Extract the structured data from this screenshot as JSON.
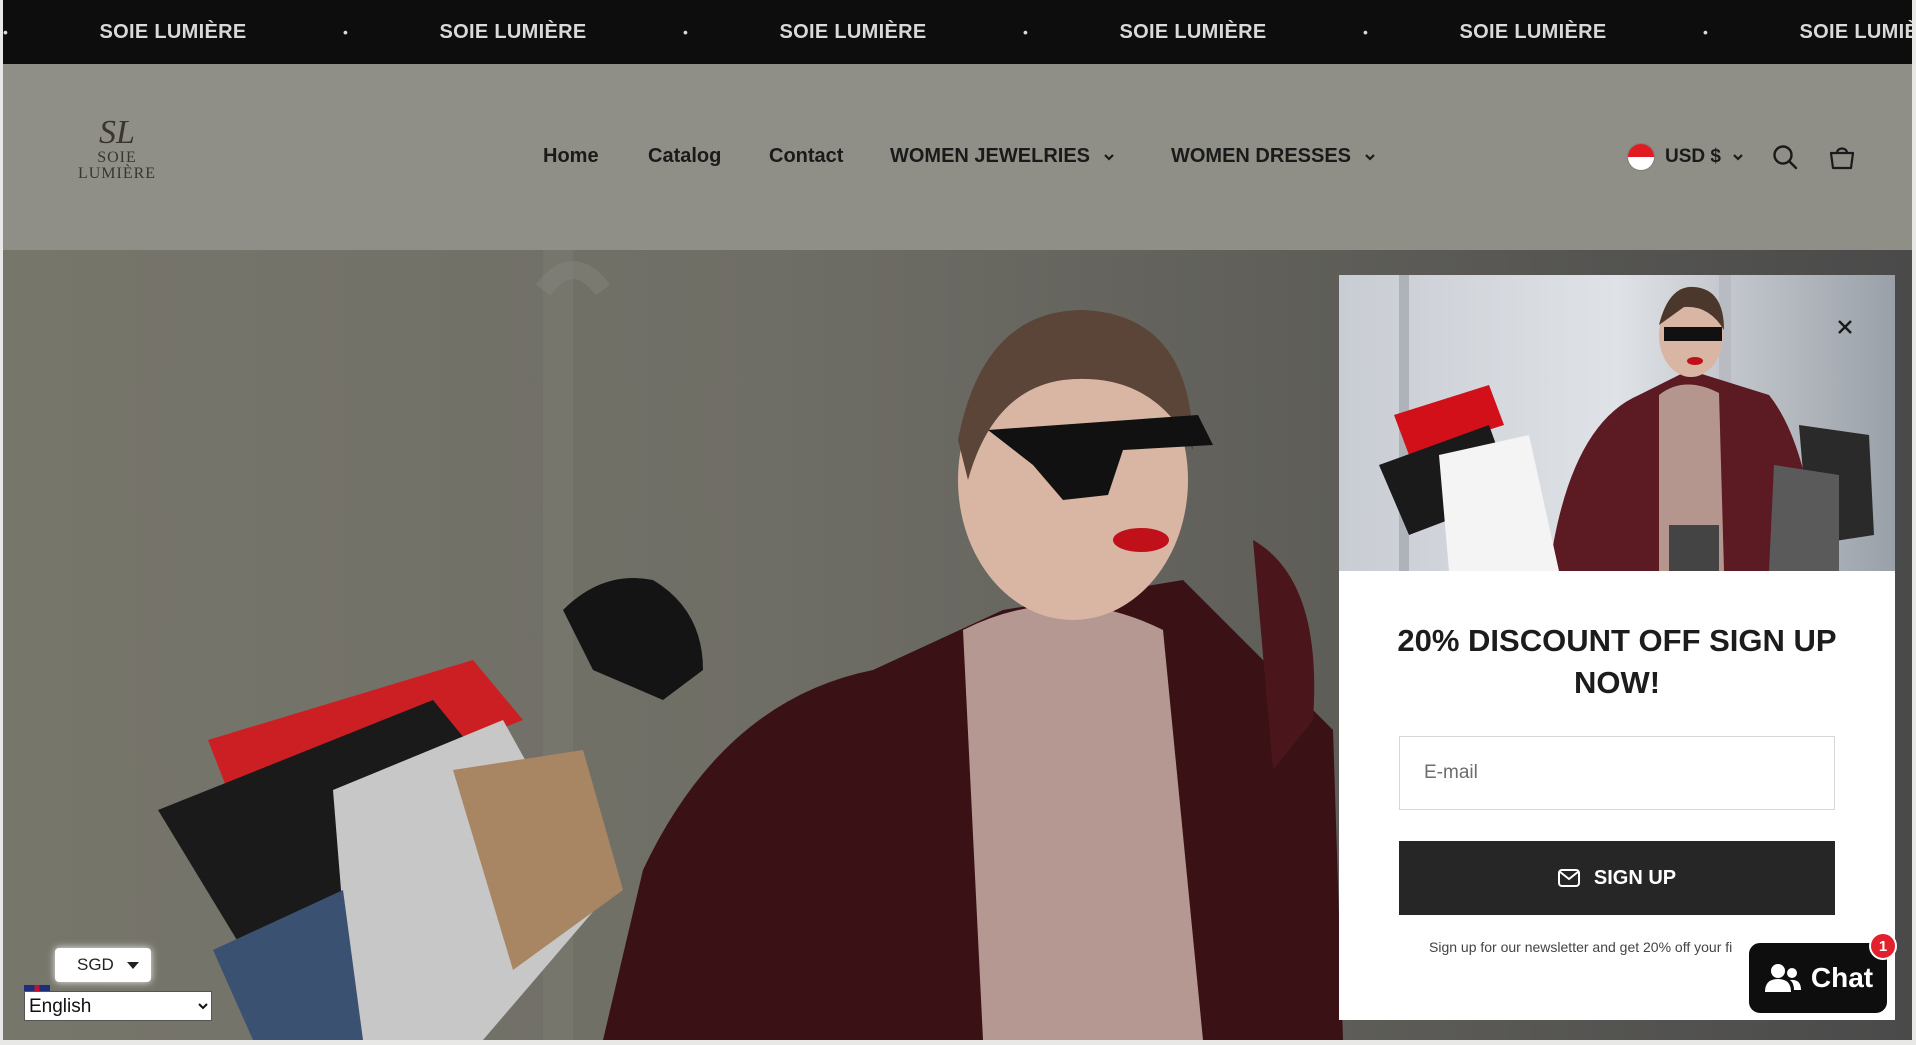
{
  "marquee": {
    "items": [
      "SOIE LUMIÈRE",
      "SOIE LUMIÈRE",
      "SOIE LUMIÈRE",
      "SOIE LUMIÈRE",
      "SOIE LUMIÈRE",
      "SOIE LUMIÈRE",
      "SOIE LUMIÈRE"
    ],
    "separator": "•"
  },
  "header": {
    "logo": {
      "mark": "SL",
      "line1": "SOIE",
      "line2": "LUMIÈRE"
    },
    "nav": [
      {
        "label": "Home",
        "has_dropdown": false
      },
      {
        "label": "Catalog",
        "has_dropdown": false
      },
      {
        "label": "Contact",
        "has_dropdown": false
      },
      {
        "label": "WOMEN JEWELRIES",
        "has_dropdown": true
      },
      {
        "label": "WOMEN DRESSES",
        "has_dropdown": true
      }
    ],
    "currency": "USD $",
    "icons": [
      "flag-icon",
      "chevron-down-icon",
      "search-icon",
      "cart-icon"
    ]
  },
  "popup": {
    "title": "20% DISCOUNT OFF SIGN UP NOW!",
    "email_placeholder": "E-mail",
    "signup_label": "SIGN UP",
    "note": "Sign up for our newsletter and get 20% off your fi"
  },
  "chat": {
    "label": "Chat",
    "badge": "1"
  },
  "currency_widget": {
    "value": "SGD"
  },
  "language_select": {
    "value": "English",
    "options": [
      "English"
    ]
  },
  "colors": {
    "marquee_bg": "#0d0d0d",
    "header_bg": "#8f8f87",
    "button_bg": "#262626",
    "badge": "#e1222e",
    "accent_red": "#e11b22"
  }
}
